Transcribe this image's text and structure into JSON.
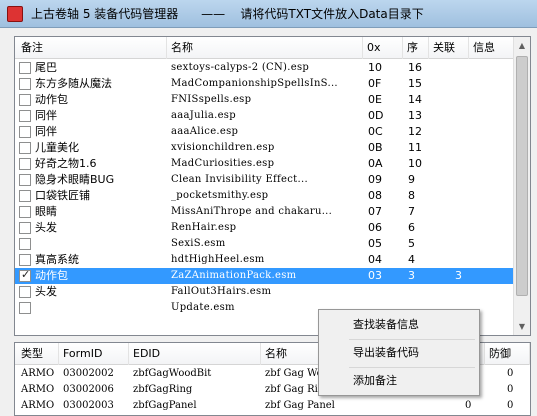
{
  "window": {
    "title": "上古卷轴 5 装备代码管理器      ——    请将代码TXT文件放入Data目录下"
  },
  "mod_list": {
    "columns": [
      "备注",
      "名称",
      "0x",
      "序",
      "关联",
      "信息"
    ],
    "rows": [
      {
        "checked": false,
        "note": "尾巴",
        "name": "sextoys-calyps-2 (CN).esp",
        "hex": "10",
        "order": "16",
        "link": "",
        "info": ""
      },
      {
        "checked": false,
        "note": "东方多随从魔法",
        "name": "MadCompanionshipSpellsInS...",
        "hex": "0F",
        "order": "15",
        "link": "",
        "info": ""
      },
      {
        "checked": false,
        "note": "动作包",
        "name": "FNISspells.esp",
        "hex": "0E",
        "order": "14",
        "link": "",
        "info": ""
      },
      {
        "checked": false,
        "note": "同伴",
        "name": "aaaJulia.esp",
        "hex": "0D",
        "order": "13",
        "link": "",
        "info": ""
      },
      {
        "checked": false,
        "note": "同伴",
        "name": "aaaAlice.esp",
        "hex": "0C",
        "order": "12",
        "link": "",
        "info": ""
      },
      {
        "checked": false,
        "note": "儿童美化",
        "name": "xvisionchildren.esp",
        "hex": "0B",
        "order": "11",
        "link": "",
        "info": ""
      },
      {
        "checked": false,
        "note": "好奇之物1.6",
        "name": "MadCuriosities.esp",
        "hex": "0A",
        "order": "10",
        "link": "",
        "info": ""
      },
      {
        "checked": false,
        "note": "隐身术眼睛BUG",
        "name": "Clean Invisibility Effect...",
        "hex": "09",
        "order": "9",
        "link": "",
        "info": ""
      },
      {
        "checked": false,
        "note": "口袋铁匠铺",
        "name": "_pocketsmithy.esp",
        "hex": "08",
        "order": "8",
        "link": "",
        "info": ""
      },
      {
        "checked": false,
        "note": "眼睛",
        "name": "MissAniThrope and chakaru...",
        "hex": "07",
        "order": "7",
        "link": "",
        "info": ""
      },
      {
        "checked": false,
        "note": "头发",
        "name": "RenHair.esp",
        "hex": "06",
        "order": "6",
        "link": "",
        "info": ""
      },
      {
        "checked": false,
        "note": "",
        "name": "SexiS.esm",
        "hex": "05",
        "order": "5",
        "link": "",
        "info": ""
      },
      {
        "checked": false,
        "note": "真高系统",
        "name": "hdtHighHeel.esm",
        "hex": "04",
        "order": "4",
        "link": "",
        "info": ""
      },
      {
        "checked": true,
        "note": "动作包",
        "name": "ZaZAnimationPack.esm",
        "hex": "03",
        "order": "3",
        "link": "3",
        "info": ""
      },
      {
        "checked": false,
        "note": "头发",
        "name": "FallOut3Hairs.esm",
        "hex": "",
        "order": "",
        "link": "",
        "info": ""
      },
      {
        "checked": false,
        "note": "",
        "name": "Update.esm",
        "hex": "",
        "order": "",
        "link": "",
        "info": ""
      }
    ],
    "selected_index": 13
  },
  "item_list": {
    "columns": [
      "类型",
      "FormID",
      "EDID",
      "名称",
      "",
      "防御"
    ],
    "rows": [
      {
        "type": "ARMO",
        "formid": "03002002",
        "edid": "zbfGagWoodBit",
        "name": "zbf Gag Wood Bit",
        "val": "0",
        "def": "0"
      },
      {
        "type": "ARMO",
        "formid": "03002006",
        "edid": "zbfGagRing",
        "name": "zbf Gag Ring",
        "val": "0",
        "def": "0"
      },
      {
        "type": "ARMO",
        "formid": "03002003",
        "edid": "zbfGagPanel",
        "name": "zbf Gag Panel",
        "val": "0",
        "def": "0"
      }
    ]
  },
  "context_menu": {
    "items": [
      "查找装备信息",
      "导出装备代码",
      "添加备注"
    ]
  },
  "colors": {
    "selection": "#3399ff",
    "titlebar": "#bcd6ee"
  }
}
